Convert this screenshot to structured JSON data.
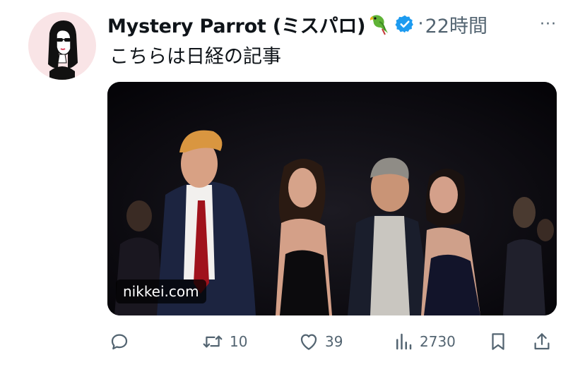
{
  "author": {
    "display_name": "Mystery Parrot (ミスパロ)",
    "emoji_icon": "parrot-icon",
    "verified": true,
    "verified_color": "#1d9bf0"
  },
  "post": {
    "separator": "·",
    "time": "22時間",
    "more_label": "···",
    "text": "こちらは日経の記事"
  },
  "media": {
    "link_label": "nikkei.com"
  },
  "actions": {
    "reply": {
      "icon": "reply-icon"
    },
    "repost": {
      "icon": "repost-icon",
      "count": "10"
    },
    "like": {
      "icon": "like-icon",
      "count": "39"
    },
    "views": {
      "icon": "views-icon",
      "count": "2730"
    },
    "bookmark": {
      "icon": "bookmark-icon"
    },
    "share": {
      "icon": "share-icon"
    }
  },
  "colors": {
    "text_primary": "#0f1419",
    "text_secondary": "#536471",
    "avatar_bg": "#f9e4e6"
  }
}
